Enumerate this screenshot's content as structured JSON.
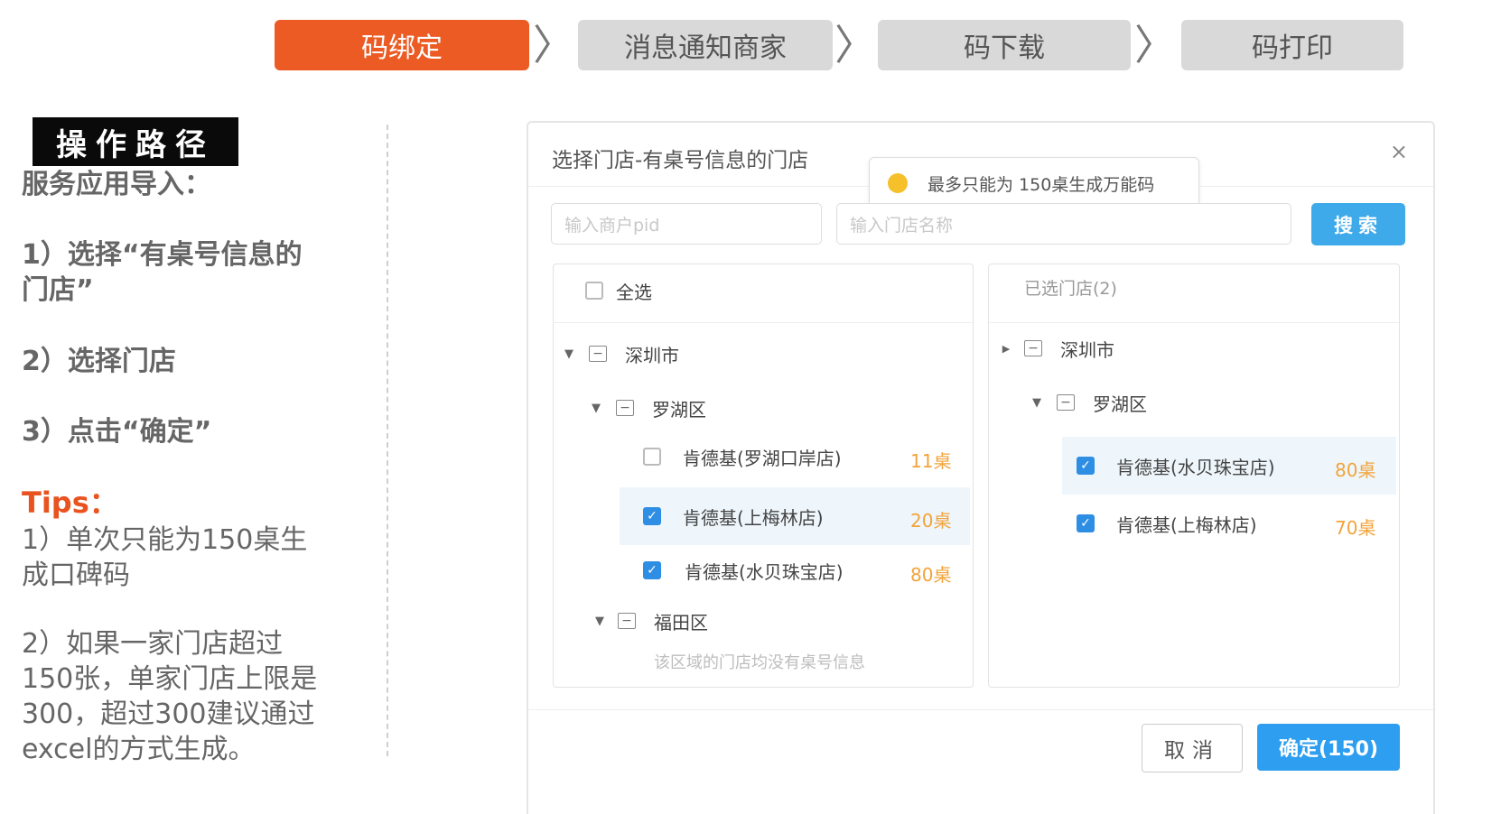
{
  "steps": [
    {
      "label": "码绑定"
    },
    {
      "label": "消息通知商家"
    },
    {
      "label": "码下载"
    },
    {
      "label": "码打印"
    }
  ],
  "step_separator": "〉",
  "left": {
    "op_path": "操作路径",
    "intro": "服务应用导入：",
    "step1_line1": "1）选择“有桌号信息的",
    "step1_line2": "门店”",
    "step2": "2）选择门店",
    "step3": "3）点击“确定”",
    "tips_label": "Tips：",
    "tip1_line1": "1）单次只能为150桌生",
    "tip1_line2": "成口碑码",
    "tip2_line1": "2）如果一家门店超过",
    "tip2_line2": "150张，单家门店上限是",
    "tip2_line3": "300，超过300建议通过",
    "tip2_line4": "excel的方式生成。"
  },
  "dialog": {
    "title": "选择门店-有桌号信息的门店",
    "close": "×",
    "tooltip": "最多只能为 150桌生成万能码",
    "pid_placeholder": "输入商户pid",
    "store_placeholder": "输入门店名称",
    "search_label": "搜索",
    "select_all": "全选",
    "selected_header": "已选门店(2)",
    "left_tree": {
      "city": "深圳市",
      "district1": "罗湖区",
      "stores": [
        {
          "name": "肯德基(罗湖口岸店)",
          "count": "11桌",
          "checked": false
        },
        {
          "name": "肯德基(上梅林店)",
          "count": "20桌",
          "checked": true
        },
        {
          "name": "肯德基(水贝珠宝店)",
          "count": "80桌",
          "checked": true
        }
      ],
      "district2": "福田区",
      "empty_note": "该区域的门店均没有桌号信息"
    },
    "right_tree": {
      "city": "深圳市",
      "district": "罗湖区",
      "stores": [
        {
          "name": "肯德基(水贝珠宝店)",
          "count": "80桌"
        },
        {
          "name": "肯德基(上梅林店)",
          "count": "70桌"
        }
      ]
    },
    "cancel_label": "取消",
    "confirm_label": "确定(150)"
  }
}
